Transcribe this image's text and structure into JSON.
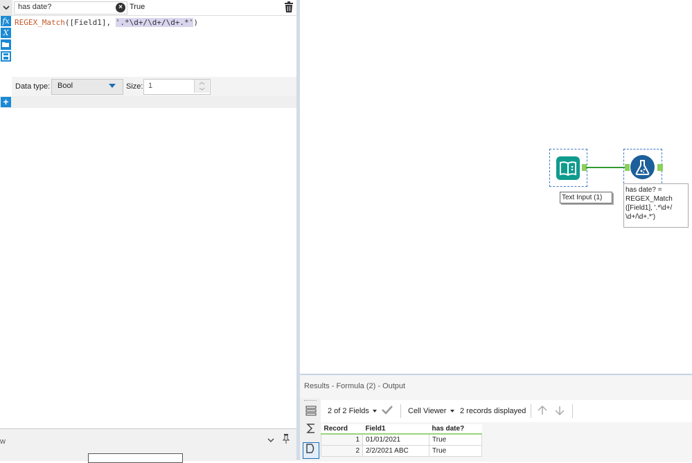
{
  "config": {
    "field_name": "has date?",
    "preview_value": "True",
    "expression": {
      "function": "REGEX_Match",
      "open": "(",
      "field": "[Field1], ",
      "pattern": "'.*\\d+/\\d+/\\d+.*'",
      "close": ")"
    },
    "toolstrip_glyphs": [
      "fx",
      "X"
    ],
    "data_type_label": "Data type:",
    "data_type_value": "Bool",
    "size_label": "Size:",
    "size_value": "1",
    "add_glyph": "+",
    "bottom_text": "w"
  },
  "canvas": {
    "text_input_label": "Text Input (1)",
    "formula_annotation": "has date? =\nREGEX_Match\n([Field1], '.*\\d+/\n\\d+/\\d+.*')"
  },
  "results": {
    "title": "Results - Formula (2) - Output",
    "fields_selector": "2 of 2 Fields",
    "viewer": "Cell Viewer",
    "records_displayed": "2 records displayed",
    "columns": [
      "Record",
      "Field1",
      "has date?"
    ],
    "rows": [
      {
        "record": "1",
        "field1": "01/01/2021",
        "has_date": "True"
      },
      {
        "record": "2",
        "field1": "2/2/2021 ABC",
        "has_date": "True"
      }
    ]
  },
  "colors": {
    "accent_blue": "#1b8ad4",
    "text_input_teal": "#0f9b8e",
    "formula_blue": "#1d5f9a",
    "connection_green": "#2f9b2f"
  },
  "icons": [
    "chevron-down-icon",
    "clear-icon",
    "trash-icon",
    "fx-icon",
    "variable-icon",
    "open-icon",
    "save-icon",
    "add-icon",
    "pin-icon",
    "book-icon",
    "flask-icon",
    "check-icon",
    "arrow-up-icon",
    "arrow-down-icon"
  ]
}
